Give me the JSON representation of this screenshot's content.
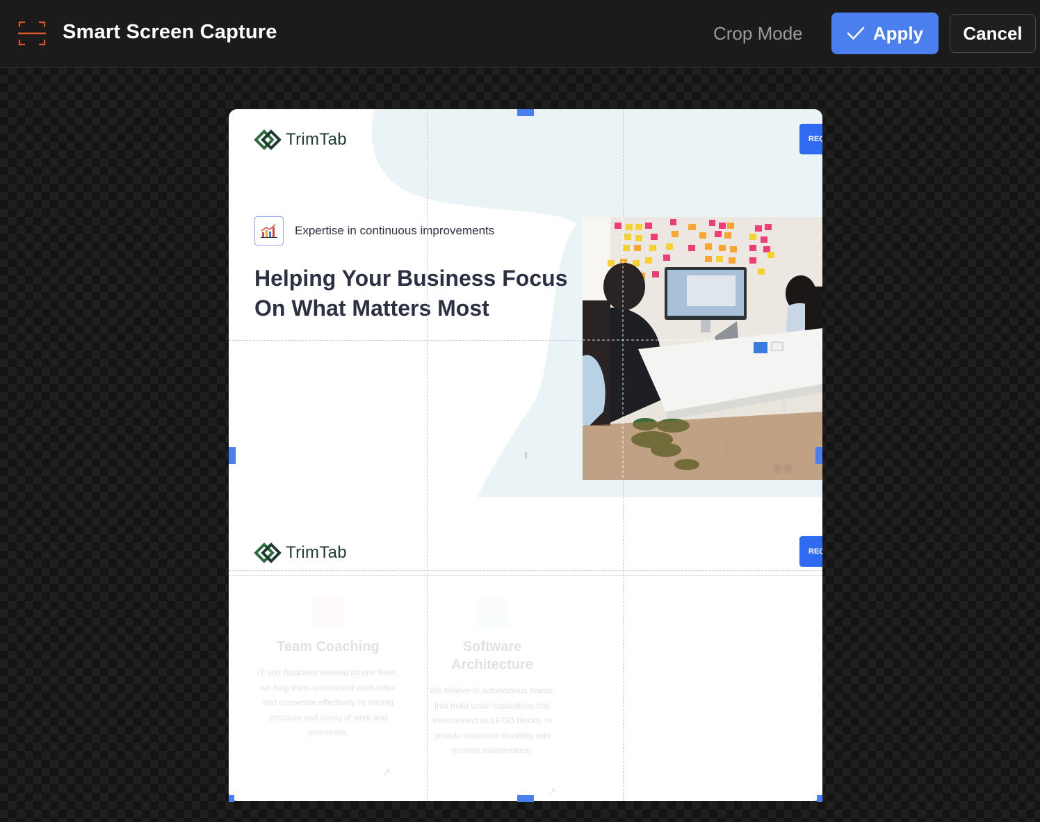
{
  "app": {
    "icon": "capture-frame-icon",
    "title": "Smart Screen Capture"
  },
  "toolbar": {
    "mode_label": "Crop Mode",
    "apply_icon": "check-icon",
    "apply_label": "Apply",
    "cancel_label": "Cancel"
  },
  "preview": {
    "header_top": {
      "logo_icon": "trimtab-logo-icon",
      "logo_text": "TrimTab",
      "request_button": "REQ"
    },
    "hero": {
      "tag_icon": "bar-chart-icon",
      "tagline": "Expertise in continuous improvements",
      "headline": "Helping Your Business Focus On What Matters Most",
      "photo": "office-team-photo"
    },
    "header_bottom": {
      "logo_text": "TrimTab",
      "request_button": "REQ"
    },
    "services": [
      {
        "icon": "pie-chart-icon",
        "title": "Team Coaching",
        "description": "IT and Business working as one team, we help them understand each other and cooperate effectively by having structure and clarity of work and processes.",
        "arrow": "↗"
      },
      {
        "icon": "monitor-icon",
        "title": "Software Architecture",
        "description": "We believe in autonomous teams, that build small capabilities that interconnect as LEGO blocks, to provide maximum flexibility with minimal maintenance.",
        "arrow": "↗"
      }
    ]
  },
  "colors": {
    "accent": "#4b7ff0",
    "topbar": "#1b1b1b",
    "brand_green": "#2d6a3e",
    "request_blue": "#2e6bf0"
  }
}
